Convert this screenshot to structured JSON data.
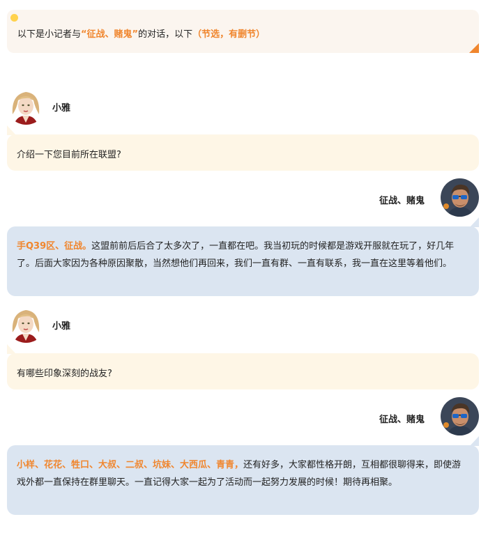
{
  "intro": {
    "prefix": "以下是小记者与",
    "guest_quoted": "“征战、赌鬼”",
    "middle": "的对话，以下",
    "note": "（节选，有删节）"
  },
  "colors": {
    "accent": "#f0862e",
    "question_bg": "#fef6e6",
    "answer_bg": "#dbe5f1",
    "intro_bg": "#fbf5ef"
  },
  "messages": [
    {
      "speaker": "小雅",
      "text": "介绍一下您目前所在联盟?"
    },
    {
      "speaker": "征战、赌鬼",
      "highlight": "手Q39区、征战。",
      "text": "这盟前前后后合了太多次了，一直都在吧。我当初玩的时候都是游戏开服就在玩了，好几年了。后面大家因为各种原因聚散，当然想他们再回来，我们一直有群、一直有联系，我一直在这里等着他们。"
    },
    {
      "speaker": "小雅",
      "text": "有哪些印象深刻的战友?"
    },
    {
      "speaker": "征战、赌鬼",
      "highlight": "小样、花花、牲口、大叔、二叔、坑妹、大西瓜、青青，",
      "text": "还有好多，大家都性格开朗，互相都很聊得来，即使游戏外都一直保持在群里聊天。一直记得大家一起为了活动而一起努力发展的时候！期待再相聚。"
    }
  ]
}
